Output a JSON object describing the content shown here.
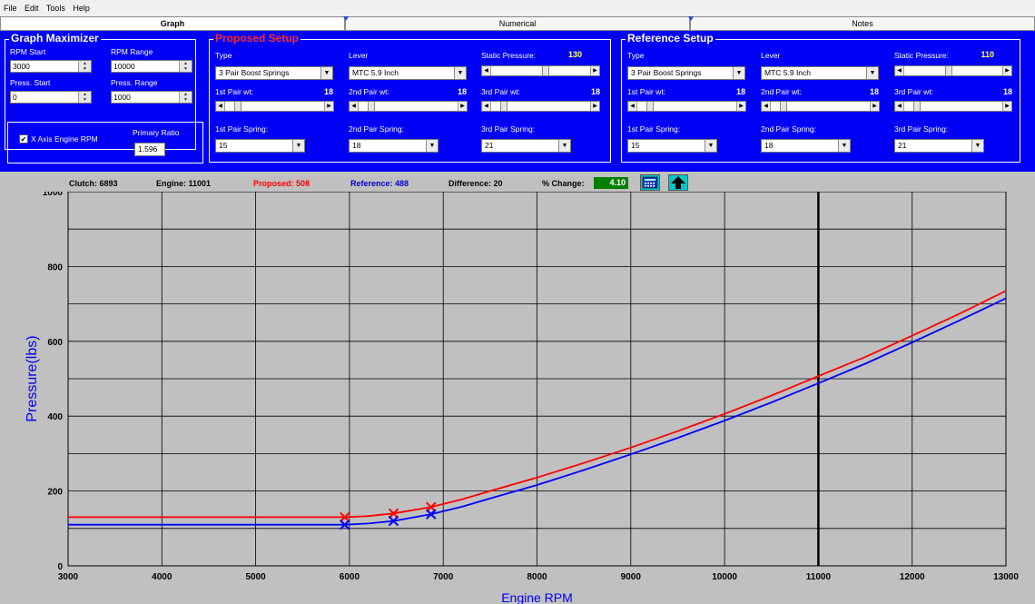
{
  "menu": [
    "File",
    "Edit",
    "Tools",
    "Help"
  ],
  "tabs": [
    {
      "label": "Graph",
      "active": true
    },
    {
      "label": "Numerical",
      "active": false
    },
    {
      "label": "Notes",
      "active": false
    }
  ],
  "maximizer": {
    "title": "Graph Maximizer",
    "rpm_start_label": "RPM Start",
    "rpm_start": "3000",
    "rpm_range_label": "RPM Range",
    "rpm_range": "10000",
    "press_start_label": "Press. Start",
    "press_start": "0",
    "press_range_label": "Press. Range",
    "press_range": "1000",
    "x_axis_label": "X Axis Engine RPM",
    "x_axis_checked": true,
    "primary_ratio_label": "Primary Ratio",
    "primary_ratio": "1.596"
  },
  "proposed": {
    "title": "Proposed Setup",
    "type_label": "Type",
    "type_value": "3 Pair Boost Springs",
    "lever_label": "Lever",
    "lever_value": "MTC 5.9 Inch",
    "static_label": "Static Pressure:",
    "static_value": "130",
    "static_slider": 0.55,
    "pair1_wt_label": "1st Pair wt:",
    "pair1_wt": "18",
    "pair1_slider": 0.1,
    "pair2_wt_label": "2nd Pair wt:",
    "pair2_wt": "18",
    "pair2_slider": 0.1,
    "pair3_wt_label": "3rd Pair wt:",
    "pair3_wt": "18",
    "pair3_slider": 0.1,
    "spring1_label": "1st Pair Spring:",
    "spring1": "15",
    "spring2_label": "2nd Pair Spring:",
    "spring2": "18",
    "spring3_label": "3rd Pair Spring:",
    "spring3": "21"
  },
  "reference": {
    "title": "Reference Setup",
    "type_label": "Type",
    "type_value": "3 Pair Boost Springs",
    "lever_label": "Lever",
    "lever_value": "MTC 5.9 Inch",
    "static_label": "Static Pressure:",
    "static_value": "110",
    "static_slider": 0.45,
    "pair1_wt_label": "1st Pair wt:",
    "pair1_wt": "18",
    "pair1_slider": 0.1,
    "pair2_wt_label": "2nd Pair wt:",
    "pair2_wt": "18",
    "pair2_slider": 0.1,
    "pair3_wt_label": "3rd Pair wt:",
    "pair3_wt": "18",
    "pair3_slider": 0.1,
    "spring1_label": "1st Pair Spring:",
    "spring1": "15",
    "spring2_label": "2nd Pair Spring:",
    "spring2": "18",
    "spring3_label": "3rd Pair Spring:",
    "spring3": "21"
  },
  "status": {
    "clutch": "Clutch: 6893",
    "engine": "Engine: 11001",
    "proposed": "Proposed: 508",
    "reference": "Reference: 488",
    "difference": "Difference: 20",
    "pct_label": "% Change:",
    "pct_value": "4.10"
  },
  "colors": {
    "panel": "#0000f5",
    "proposed": "#ff0000",
    "reference": "#0000ff",
    "pct_bg": "#008000",
    "plot_bg": "#c0c0c0"
  },
  "icons": [
    "calculator-icon",
    "up-arrow-icon"
  ],
  "chart_data": {
    "type": "line",
    "xlabel": "Engine RPM",
    "ylabel": "Pressure(lbs)",
    "xlim": [
      3000,
      13000
    ],
    "ylim": [
      0,
      1000
    ],
    "xticks": [
      3000,
      4000,
      5000,
      6000,
      7000,
      8000,
      9000,
      10000,
      11000,
      12000,
      13000
    ],
    "yticks": [
      0,
      200,
      400,
      600,
      800,
      1000
    ],
    "grid": true,
    "cursor_x": 11000,
    "series": [
      {
        "name": "Proposed",
        "color": "#ff0000",
        "points": [
          [
            3000,
            130
          ],
          [
            5950,
            130
          ],
          [
            6200,
            133
          ],
          [
            6470,
            140
          ],
          [
            6870,
            157
          ],
          [
            7200,
            178
          ],
          [
            7500,
            200
          ],
          [
            8000,
            236
          ],
          [
            8500,
            275
          ],
          [
            9000,
            316
          ],
          [
            9500,
            360
          ],
          [
            10000,
            406
          ],
          [
            10500,
            455
          ],
          [
            11000,
            507
          ],
          [
            11500,
            558
          ],
          [
            12000,
            615
          ],
          [
            12500,
            673
          ],
          [
            13000,
            735
          ]
        ],
        "markers": [
          [
            5950,
            130
          ],
          [
            6470,
            140
          ],
          [
            6870,
            157
          ]
        ]
      },
      {
        "name": "Reference",
        "color": "#0000ff",
        "points": [
          [
            3000,
            110
          ],
          [
            5950,
            110
          ],
          [
            6200,
            113
          ],
          [
            6470,
            120
          ],
          [
            6870,
            138
          ],
          [
            7200,
            158
          ],
          [
            7500,
            180
          ],
          [
            8000,
            216
          ],
          [
            8500,
            256
          ],
          [
            9000,
            298
          ],
          [
            9500,
            342
          ],
          [
            10000,
            388
          ],
          [
            10500,
            437
          ],
          [
            11000,
            488
          ],
          [
            11500,
            540
          ],
          [
            12000,
            597
          ],
          [
            12500,
            655
          ],
          [
            13000,
            715
          ]
        ],
        "markers": [
          [
            5950,
            110
          ],
          [
            6470,
            120
          ],
          [
            6870,
            138
          ]
        ]
      }
    ]
  }
}
